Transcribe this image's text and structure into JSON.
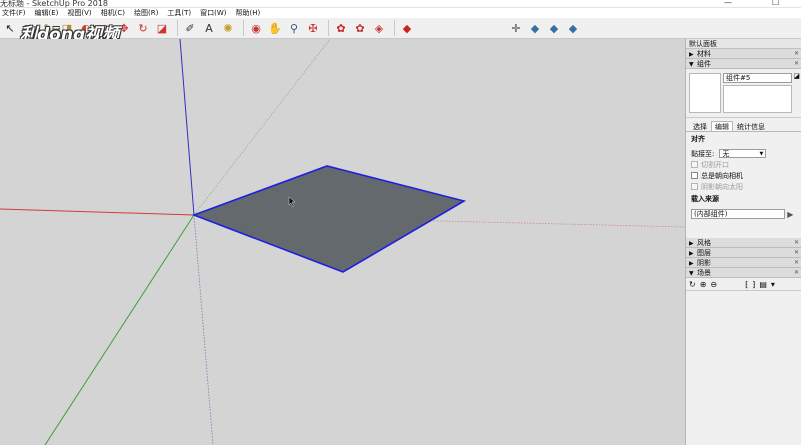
{
  "window": {
    "title": "无标题 - SketchUp Pro 2018",
    "minimize": "—",
    "maximize": "☐"
  },
  "menu": {
    "items": [
      "文件(F)",
      "编辑(E)",
      "视图(V)",
      "相机(C)",
      "绘图(R)",
      "工具(T)",
      "窗口(W)",
      "帮助(H)"
    ]
  },
  "watermark": "利dōng视频",
  "toolbar": {
    "icons": [
      {
        "name": "select-arrow-icon",
        "glyph": "↖",
        "color": "#222"
      },
      {
        "name": "eraser-icon",
        "glyph": "◩",
        "color": "#cc3333"
      },
      {
        "name": "pencil-icon",
        "glyph": "✎",
        "color": "#aa6622"
      },
      {
        "name": "push-pull-icon",
        "glyph": "◨",
        "color": "#b58b3a"
      },
      {
        "name": "follow-me-icon",
        "glyph": "◐",
        "color": "#cc4422"
      },
      {
        "name": "offset-icon",
        "glyph": "◍",
        "color": "#d62c2c"
      },
      {
        "name": "move-icon",
        "glyph": "✥",
        "color": "#d62c2c"
      },
      {
        "name": "rotate-icon",
        "glyph": "↻",
        "color": "#d62c2c"
      },
      {
        "name": "scale-icon",
        "glyph": "◪",
        "color": "#cc3333"
      },
      {
        "name": "tape-measure-icon",
        "glyph": "✐",
        "color": "#333"
      },
      {
        "name": "text-icon",
        "glyph": "A",
        "color": "#333"
      },
      {
        "name": "paint-bucket-icon",
        "glyph": "✺",
        "color": "#c79a2a"
      },
      {
        "name": "orbit-icon",
        "glyph": "◉",
        "color": "#cc3333"
      },
      {
        "name": "pan-icon",
        "glyph": "✋",
        "color": "#c49a5a"
      },
      {
        "name": "zoom-icon",
        "glyph": "⚲",
        "color": "#335577"
      },
      {
        "name": "zoom-extents-icon",
        "glyph": "✠",
        "color": "#cc3333"
      },
      {
        "name": "warehouse-icon",
        "glyph": "✿",
        "color": "#cc2222"
      },
      {
        "name": "extension-warehouse-icon",
        "glyph": "✿",
        "color": "#bb3333"
      },
      {
        "name": "share-model-icon",
        "glyph": "◈",
        "color": "#cc3333"
      },
      {
        "name": "extension-manager-icon",
        "glyph": "◆",
        "color": "#cc2222"
      },
      {
        "name": "axes-icon",
        "glyph": "✛",
        "color": "#444"
      },
      {
        "name": "iso-view-icon",
        "glyph": "◆",
        "color": "#3a6ea8"
      },
      {
        "name": "top-view-icon",
        "glyph": "◆",
        "color": "#3a6ea8"
      },
      {
        "name": "front-view-icon",
        "glyph": "◆",
        "color": "#3a6ea8"
      }
    ]
  },
  "panel": {
    "title": "默认面板",
    "sections": {
      "materials": "材料",
      "components": "组件",
      "styles": "风格",
      "layers": "图层",
      "shadows": "阴影",
      "scenes": "场景"
    },
    "close_icon": "✕",
    "component": {
      "name_value": "组件#5",
      "side_icon": "◪"
    },
    "tabs": [
      "选择",
      "编辑",
      "统计信息"
    ],
    "active_tab": "编辑",
    "align": {
      "heading": "对齐",
      "glue_label": "黏接至:",
      "glue_value": "无",
      "cut_opening": "切割开口",
      "always_face_camera": "总是朝向相机",
      "shadows_face_sun": "阴影朝向太阳"
    },
    "load_from": {
      "heading": "载入来源",
      "value": "(内部组件)",
      "button": "▶"
    },
    "scene_tools": [
      "↻",
      "⊕",
      "⊖",
      "⁅",
      "⁆",
      "▤",
      "▾"
    ]
  },
  "colors": {
    "accent_blue": "#1f1fe0",
    "face_fill": "#63696d",
    "axis_red": "#d23a3a",
    "axis_green": "#3aa03a",
    "axis_blue": "#3030c0"
  }
}
